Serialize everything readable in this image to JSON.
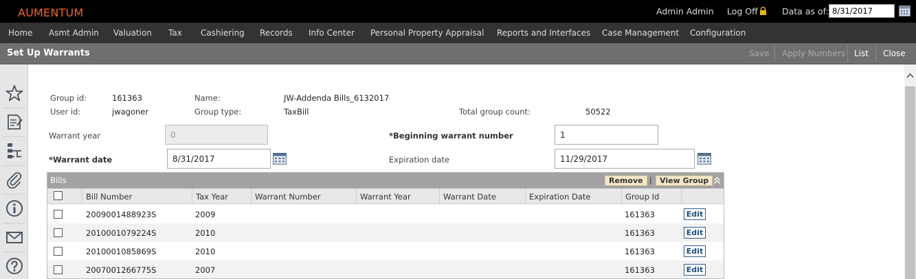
{
  "app": {
    "logo": "AUMENTUM",
    "user_name": "Admin Admin",
    "logoff_label": "Log Off",
    "data_as_of_label": "Data as of:",
    "data_as_of_value": "8/31/2017"
  },
  "nav": [
    "Home",
    "Asmt Admin",
    "Valuation",
    "Tax",
    "Cashiering",
    "Records",
    "Info Center",
    "Personal Property Appraisal",
    "Reports and Interfaces",
    "Case Management",
    "Configuration"
  ],
  "page": {
    "title": "Set Up Warrants",
    "buttons": {
      "save": "Save",
      "apply_numbers": "Apply Numbers",
      "list": "List",
      "close": "Close"
    }
  },
  "sidebar_icons": [
    "star-icon",
    "notes-icon",
    "hierarchy-icon",
    "attachment-icon",
    "info-icon",
    "mail-icon",
    "help-icon"
  ],
  "info": {
    "group_id_label": "Group id:",
    "group_id": "161363",
    "name_label": "Name:",
    "name": "JW-Addenda Bills_6132017",
    "user_id_label": "User id:",
    "user_id": "jwagoner",
    "group_type_label": "Group type:",
    "group_type": "TaxBill",
    "total_count_label": "Total group count:",
    "total_count": "50522"
  },
  "form": {
    "warrant_year_label": "Warrant year",
    "warrant_year_value": "0",
    "beginning_number_label": "*Beginning warrant number",
    "beginning_number_value": "1",
    "warrant_date_label": "*Warrant date",
    "warrant_date_value": "8/31/2017",
    "expiration_date_label": "Expiration date",
    "expiration_date_value": "11/29/2017"
  },
  "bills": {
    "title": "Bills",
    "remove_label": "Remove",
    "separator": "|",
    "view_group_label": "View Group",
    "edit_label": "Edit",
    "columns": [
      "Bill Number",
      "Tax Year",
      "Warrant Number",
      "Warrant Year",
      "Warrant Date",
      "Expiration Date",
      "Group Id"
    ],
    "rows": [
      {
        "bill_number": "2009001488923S",
        "tax_year": "2009",
        "warrant_number": "",
        "warrant_year": "",
        "warrant_date": "",
        "expiration_date": "",
        "group_id": "161363"
      },
      {
        "bill_number": "2010001079224S",
        "tax_year": "2010",
        "warrant_number": "",
        "warrant_year": "",
        "warrant_date": "",
        "expiration_date": "",
        "group_id": "161363"
      },
      {
        "bill_number": "2010001085869S",
        "tax_year": "2010",
        "warrant_number": "",
        "warrant_year": "",
        "warrant_date": "",
        "expiration_date": "",
        "group_id": "161363"
      },
      {
        "bill_number": "2007001266775S",
        "tax_year": "2007",
        "warrant_number": "",
        "warrant_year": "",
        "warrant_date": "",
        "expiration_date": "",
        "group_id": "161363"
      }
    ]
  },
  "colors": {
    "logo": "#f26522",
    "topbar": "#000000",
    "navbar": "#333333",
    "pagebar": "#6f6f6f",
    "grid_header": "#a3a3a3",
    "edit_button": "#1f4e79"
  }
}
